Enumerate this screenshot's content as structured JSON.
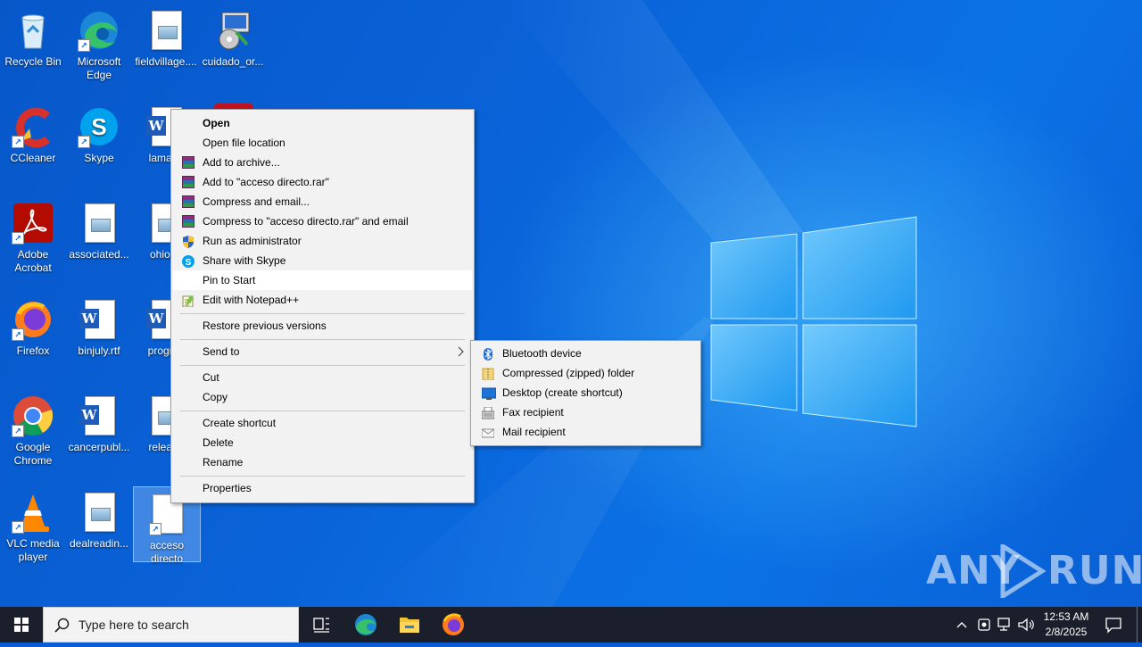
{
  "desktop": {
    "icons": [
      {
        "label": "Recycle Bin"
      },
      {
        "label": "Microsoft Edge"
      },
      {
        "label": "fieldvillage...."
      },
      {
        "label": "cuidado_or..."
      },
      {
        "label": "CCleaner"
      },
      {
        "label": "Skype"
      },
      {
        "label": "lamazo"
      },
      {
        "label": "Adobe Acrobat"
      },
      {
        "label": "associated..."
      },
      {
        "label": "ohioph"
      },
      {
        "label": "Firefox"
      },
      {
        "label": "binjuly.rtf"
      },
      {
        "label": "progres"
      },
      {
        "label": "Google Chrome"
      },
      {
        "label": "cancerpubl..."
      },
      {
        "label": "release"
      },
      {
        "label": "VLC media player"
      },
      {
        "label": "dealreadin..."
      },
      {
        "label": "acceso directo"
      }
    ]
  },
  "context_menu": {
    "items": [
      {
        "label": "Open",
        "icon": "none",
        "bold": true
      },
      {
        "label": "Open file location",
        "icon": "none"
      },
      {
        "label": "Add to archive...",
        "icon": "winrar-icon"
      },
      {
        "label": "Add to \"acceso directo.rar\"",
        "icon": "winrar-icon"
      },
      {
        "label": "Compress and email...",
        "icon": "winrar-icon"
      },
      {
        "label": "Compress to \"acceso directo.rar\" and email",
        "icon": "winrar-icon"
      },
      {
        "label": "Run as administrator",
        "icon": "uac-shield-icon"
      },
      {
        "label": "Share with Skype",
        "icon": "skype-icon"
      },
      {
        "label": "Pin to Start",
        "icon": "none",
        "highlighted": true
      },
      {
        "label": "Edit with Notepad++",
        "icon": "notepadpp-icon"
      },
      {
        "label": "Restore previous versions",
        "icon": "none"
      },
      {
        "label": "Send to",
        "icon": "none",
        "submenu": true
      },
      {
        "label": "Cut",
        "icon": "none"
      },
      {
        "label": "Copy",
        "icon": "none"
      },
      {
        "label": "Create shortcut",
        "icon": "none"
      },
      {
        "label": "Delete",
        "icon": "none"
      },
      {
        "label": "Rename",
        "icon": "none"
      },
      {
        "label": "Properties",
        "icon": "none"
      }
    ]
  },
  "send_to_menu": {
    "items": [
      {
        "label": "Bluetooth device",
        "icon": "bluetooth-icon"
      },
      {
        "label": "Compressed (zipped) folder",
        "icon": "zip-folder-icon"
      },
      {
        "label": "Desktop (create shortcut)",
        "icon": "desktop-icon"
      },
      {
        "label": "Fax recipient",
        "icon": "fax-icon"
      },
      {
        "label": "Mail recipient",
        "icon": "mail-icon"
      }
    ]
  },
  "taskbar": {
    "search_placeholder": "Type here to search",
    "pinned": [
      "task-view-icon",
      "edge-icon",
      "file-explorer-icon",
      "firefox-icon"
    ],
    "clock_time": "12:53 AM",
    "clock_date": "2/8/2025"
  },
  "watermark": {
    "left": "ANY",
    "right": "RUN"
  },
  "colors": {
    "desktop_blue": "#0a5bd6",
    "taskbar": "#1a1f2b",
    "menu_bg": "#f2f2f2",
    "menu_highlight": "#ffffff"
  }
}
